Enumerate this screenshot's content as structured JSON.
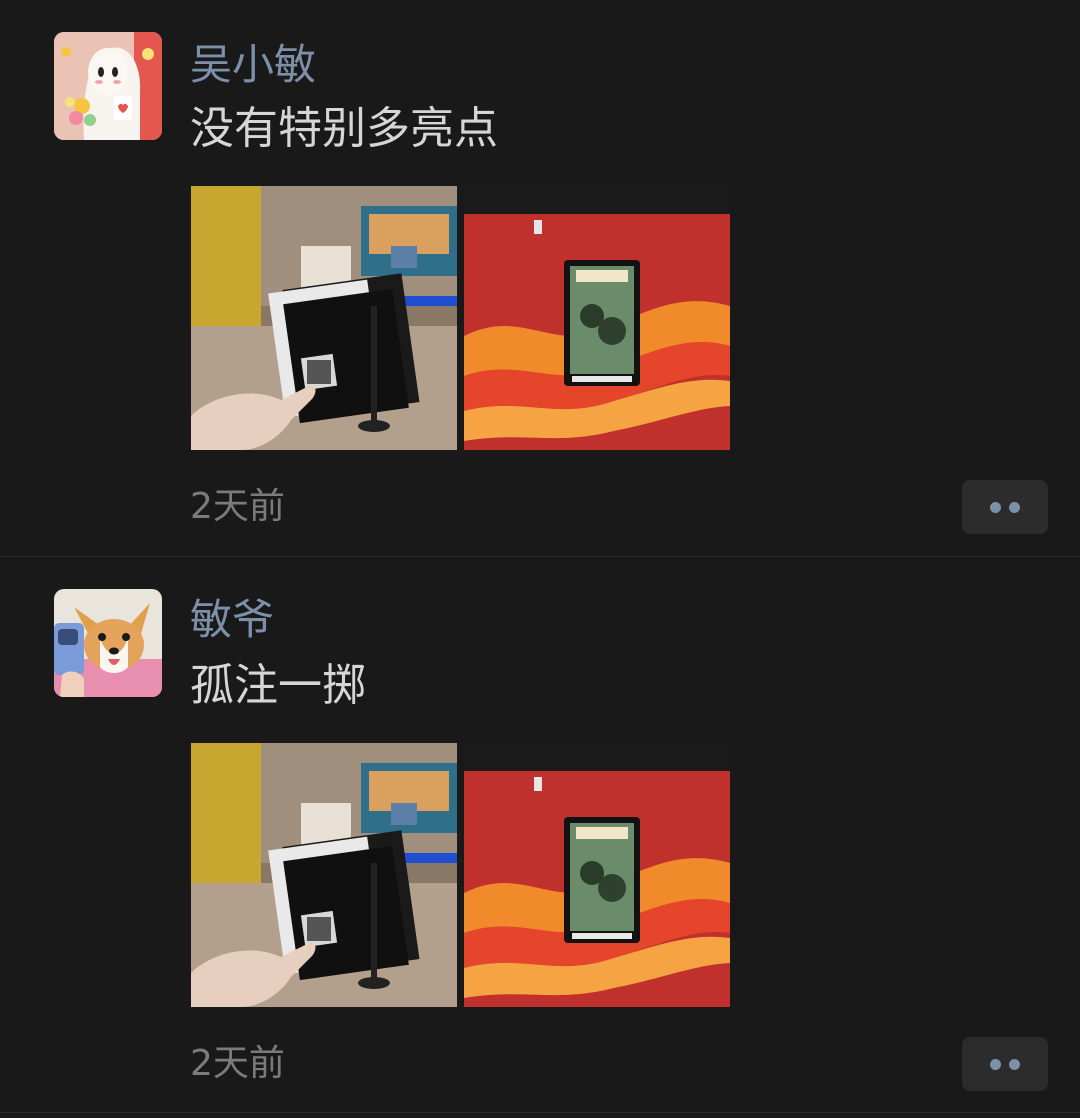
{
  "posts": [
    {
      "username": "吴小敏",
      "text": "没有特别多亮点",
      "timestamp": "2天前",
      "avatar": "ghost-with-flowers-avatar",
      "photos": [
        "cinema-tickets-photo",
        "movie-poster-red-wall-photo"
      ]
    },
    {
      "username": "敏爷",
      "text": "孤注一掷",
      "timestamp": "2天前",
      "avatar": "corgi-avatar",
      "photos": [
        "cinema-tickets-photo",
        "movie-poster-red-wall-photo"
      ]
    }
  ],
  "colors": {
    "background": "#191919",
    "username": "#7d90a9",
    "text": "#d6d6d6",
    "timestamp": "#7b7b7b",
    "button": "#2c2c2c"
  }
}
